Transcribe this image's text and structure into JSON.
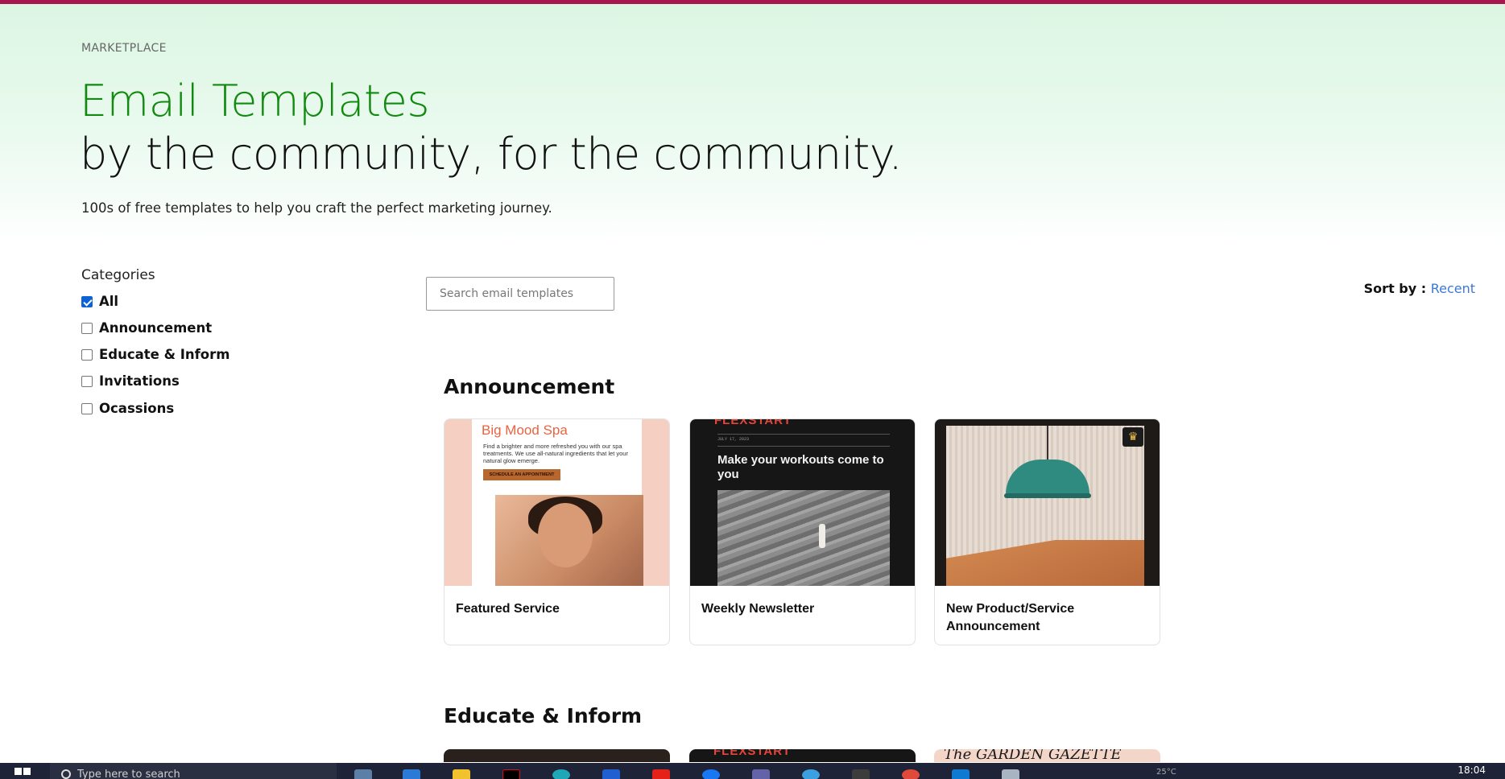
{
  "hero": {
    "eyebrow": "MARKETPLACE",
    "title_line1": "Email Templates",
    "title_line2": "by the community, for the community.",
    "subtitle": "100s of free templates to help you craft the perfect marketing journey."
  },
  "categories": {
    "title": "Categories",
    "items": [
      {
        "label": "All",
        "checked": true
      },
      {
        "label": "Announcement",
        "checked": false
      },
      {
        "label": "Educate & Inform",
        "checked": false
      },
      {
        "label": "Invitations",
        "checked": false
      },
      {
        "label": "Ocassions",
        "checked": false
      }
    ]
  },
  "search": {
    "placeholder": "Search email templates",
    "value": ""
  },
  "sort": {
    "label": "Sort by : ",
    "value": "Recent"
  },
  "sections": [
    {
      "title": "Announcement",
      "cards": [
        {
          "label": "Featured Service",
          "thumb": {
            "brand": "Big Mood Spa",
            "copy": "Find a brighter and more refreshed you with our spa treatments. We use all-natural ingredients that let your natural glow emerge.",
            "cta": "SCHEDULE AN APPOINTMENT"
          }
        },
        {
          "label": "Weekly Newsletter",
          "thumb": {
            "brand": "FLEXSTART",
            "date": "JULY 17, 2023",
            "headline": "Make your workouts come to you"
          }
        },
        {
          "label": "New Product/Service Announcement",
          "thumb": {
            "badge_icon": "crown-icon",
            "badge_glyph": "♛"
          }
        }
      ]
    },
    {
      "title": "Educate & Inform",
      "peek": [
        "",
        "FLEXSTART",
        "The GARDEN GAZETTE"
      ]
    }
  ],
  "taskbar": {
    "search_placeholder": "Type here to search",
    "clock": "18:04",
    "tray": "25°C"
  },
  "colors": {
    "topbar": "#a8164f",
    "title_green": "#118a0f",
    "sort_value": "#3a78d8",
    "checkbox_checked": "#0b63d6"
  }
}
